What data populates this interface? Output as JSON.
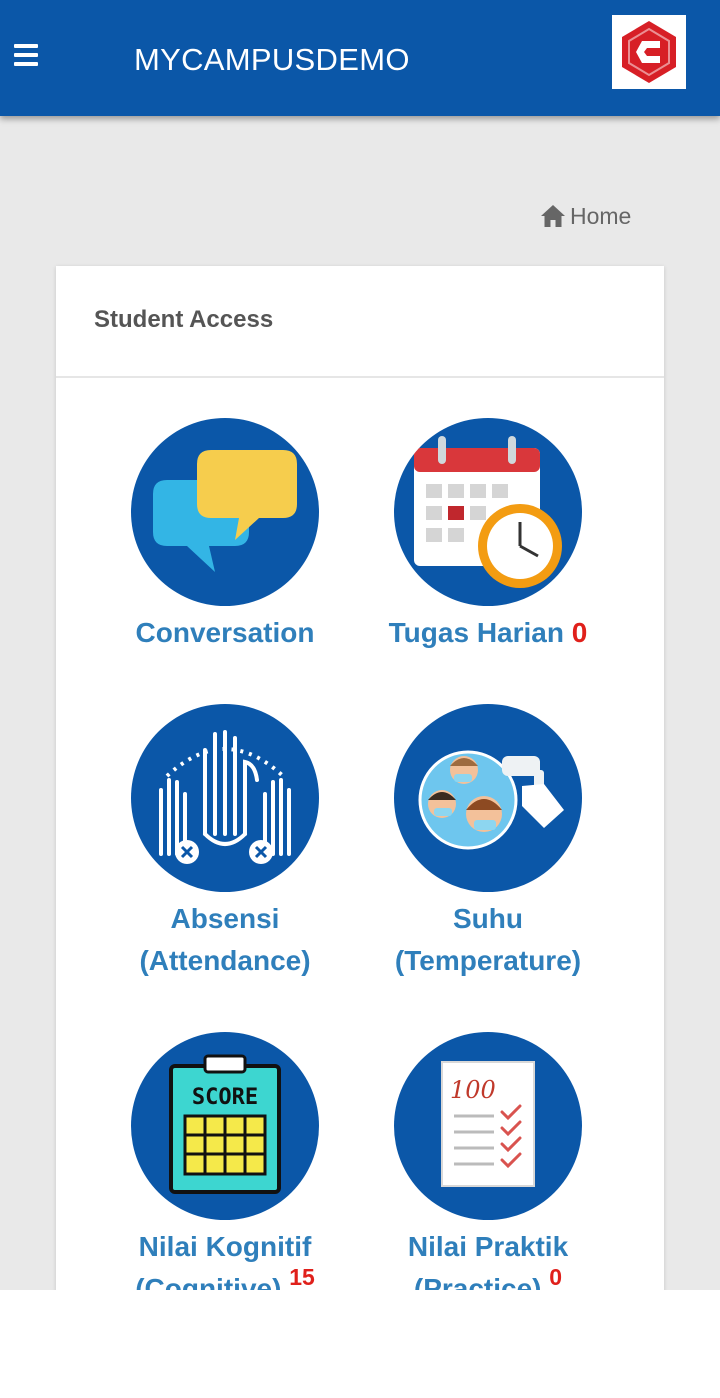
{
  "appbar": {
    "title": "MYCAMPUSDEMO",
    "menu_icon": "hamburger-menu-icon",
    "logo_icon": "campus-logo-icon",
    "colors": {
      "primary": "#0b57a8",
      "logo_red": "#d71f26"
    }
  },
  "breadcrumb": {
    "home_label": "Home",
    "icon": "home-icon"
  },
  "card": {
    "title": "Student Access",
    "tiles": [
      {
        "label": "Conversation",
        "badge": "",
        "icon": "chat-bubbles-icon"
      },
      {
        "label": "Tugas Harian",
        "badge": "0",
        "icon": "calendar-clock-icon"
      },
      {
        "label_line1": "Absensi",
        "label_line2": "(Attendance)",
        "icon": "raised-hands-icon"
      },
      {
        "label_line1": "Suhu",
        "label_line2": "(Temperature)",
        "icon": "thermometer-people-icon"
      },
      {
        "label_line1": "Nilai Kognitif",
        "label_line2": "(Cognitive)",
        "badge": "15",
        "icon": "score-clipboard-icon",
        "score_text": "SCORE"
      },
      {
        "label_line1": "Nilai Praktik",
        "label_line2": "(Practice)",
        "badge": "0",
        "icon": "checklist-paper-icon",
        "paper_text": "100"
      }
    ]
  },
  "colors": {
    "label_blue": "#2f7fbb",
    "badge_red": "#e0201b",
    "background": "#e9e9e9"
  }
}
